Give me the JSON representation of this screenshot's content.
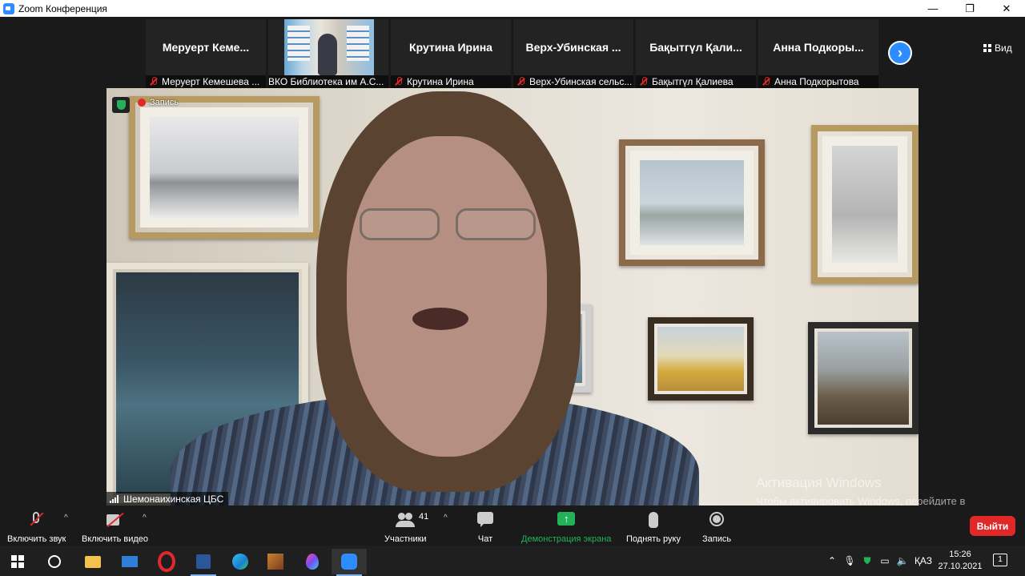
{
  "window": {
    "title": "Zoom Конференция",
    "minimize": "—",
    "restore": "❐",
    "close": "✕"
  },
  "gallery": {
    "tiles": [
      {
        "name": "Меруерт  Кеме...",
        "label": "Меруерт Кемешева ..."
      },
      {
        "name": "",
        "label": "ВКО Библиотека им А.С..."
      },
      {
        "name": "Крутина Ирина",
        "label": "Крутина Ирина"
      },
      {
        "name": "Верх-Убинская ...",
        "label": "Верх-Убинская сельс..."
      },
      {
        "name": "Бақытгүл Қали...",
        "label": "Бақытгүл Қалиева"
      },
      {
        "name": "Анна  Подкоры...",
        "label": "Анна Подкорытова"
      }
    ],
    "next": "›",
    "view_label": "Вид"
  },
  "video": {
    "recording_label": "Запись",
    "speaker_name": "Шемонаихинская ЦБС"
  },
  "activation": {
    "title": "Активация Windows",
    "body": "Чтобы активировать Windows, перейдите в раздел \"Параметры\"."
  },
  "toolbar": {
    "mute": "Включить звук",
    "video": "Включить видео",
    "participants": "Участники",
    "participants_count": "41",
    "chat": "Чат",
    "share": "Демонстрация экрана",
    "raise_hand": "Поднять руку",
    "record": "Запись",
    "leave": "Выйти",
    "caret": "^"
  },
  "taskbar": {
    "language": "ҚАЗ",
    "time": "15:26",
    "date": "27.10.2021",
    "notifications": "1"
  },
  "colors": {
    "accent": "#2d8cff",
    "danger": "#e02828",
    "share_green": "#23b25a"
  }
}
